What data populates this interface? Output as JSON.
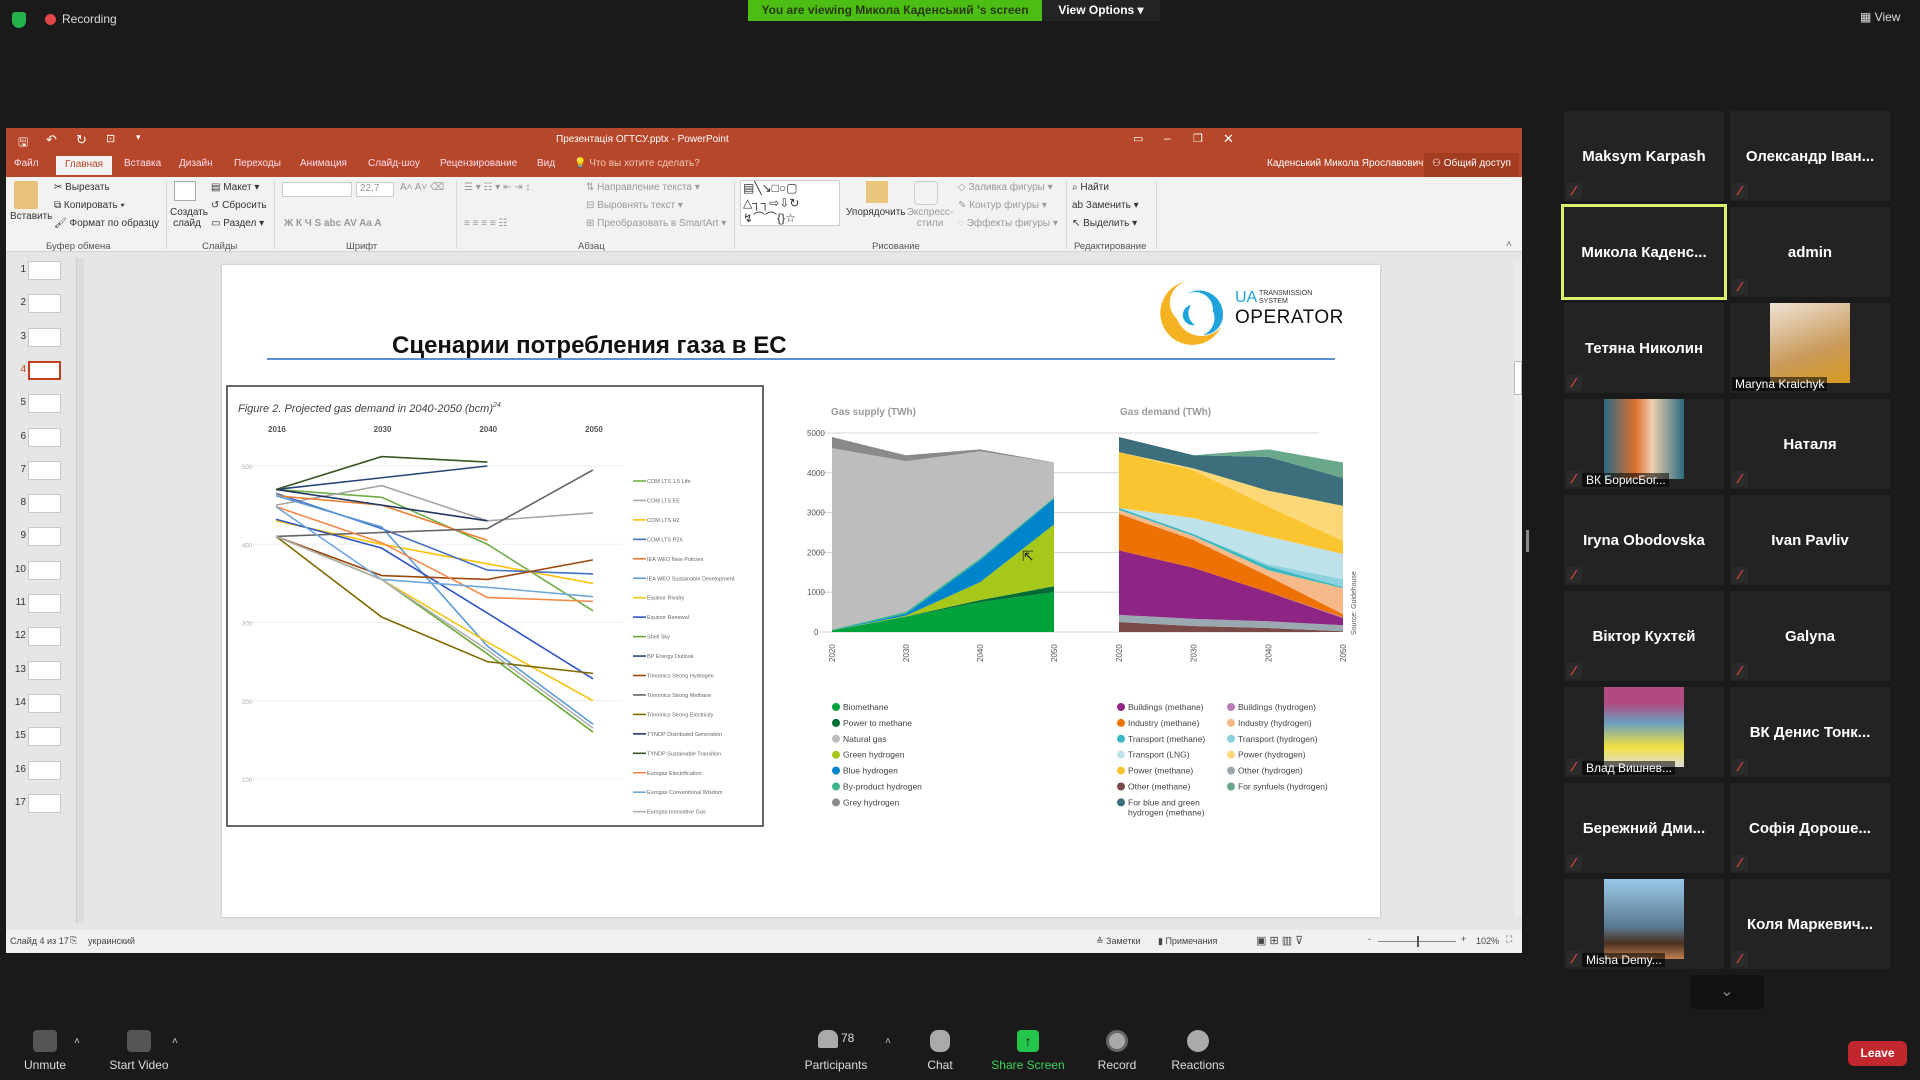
{
  "zoom_top": {
    "recording": "Recording",
    "banner": "You are viewing Микола Каденський 's screen",
    "view_options": "View Options",
    "view": "View"
  },
  "ppt": {
    "title": "Презентація ОГТСУ.pptx - PowerPoint",
    "user": "Каденський Микола Ярославович",
    "share": "Общий доступ",
    "tabs": [
      "Файл",
      "Главная",
      "Вставка",
      "Дизайн",
      "Переходы",
      "Анимация",
      "Слайд-шоу",
      "Рецензирование",
      "Вид"
    ],
    "tell_me": "Что вы хотите сделать?",
    "ribbon": {
      "paste": "Вставить",
      "cut": "Вырезать",
      "copy": "Копировать",
      "format_painter": "Формат по образцу",
      "new_slide": "Создать слайд",
      "layout": "Макет",
      "reset": "Сбросить",
      "section": "Раздел",
      "font_size": "22,7",
      "text_direction": "Направление текста",
      "align_text": "Выровнять текст",
      "smartart": "Преобразовать в SmartArt",
      "arrange": "Упорядочить",
      "quick_styles": "Экспресс-стили",
      "shape_fill": "Заливка фигуры",
      "shape_outline": "Контур фигуры",
      "shape_effects": "Эффекты фигуры",
      "find": "Найти",
      "replace": "Заменить",
      "select": "Выделить",
      "groups": [
        "Буфер обмена",
        "Слайды",
        "Шрифт",
        "Абзац",
        "Рисование",
        "Редактирование"
      ]
    },
    "slide_count": 17,
    "current_slide": 4,
    "status": {
      "slide": "Слайд 4 из 17",
      "lang": "украинский",
      "notes": "Заметки",
      "comments": "Примечания",
      "zoom": "102%",
      "zoom_level": 0.5
    }
  },
  "slide": {
    "title": "Сценарии потребления газа в ЕС",
    "logo": {
      "ua": "UA",
      "line1": "TRANSMISSION",
      "line2": "SYSTEM",
      "operator": "OPERATOR"
    },
    "source": "Source: Guidehouse"
  },
  "chart_data": [
    {
      "type": "line",
      "title": "Figure 2. Projected gas demand in 2040-2050 (bcm)",
      "title_sup": "24",
      "categories": [
        "2016",
        "2030",
        "2040",
        "2050"
      ],
      "yticks": [
        100,
        200,
        300,
        400,
        500
      ],
      "ylim": [
        50,
        530
      ],
      "grid": true,
      "legend": "right",
      "series": [
        {
          "name": "COM LTS 1.5 Life",
          "color": "#70ad47",
          "values": [
            470,
            460,
            400,
            315
          ]
        },
        {
          "name": "COM LTS EE",
          "color": "#a5a5a5",
          "values": [
            450,
            475,
            430,
            440
          ]
        },
        {
          "name": "COM LTS H2",
          "color": "#ffc000",
          "values": [
            430,
            400,
            375,
            350
          ]
        },
        {
          "name": "COM LTS P2X",
          "color": "#4472c4",
          "values": [
            465,
            420,
            367,
            362
          ]
        },
        {
          "name": "IEA WEO New Policies",
          "color": "#ed7d31",
          "values": [
            462,
            450,
            405,
            null
          ]
        },
        {
          "name": "IEA WEO Sustainable Development",
          "color": "#5b9bd5",
          "values": [
            462,
            422,
            270,
            170
          ]
        },
        {
          "name": "Equinor Rivalry",
          "color": "#f5c518",
          "values": [
            410,
            355,
            275,
            200
          ]
        },
        {
          "name": "Equinor Renewal",
          "color": "#2f55c4",
          "values": [
            432,
            395,
            312,
            228
          ]
        },
        {
          "name": "Shell Sky",
          "color": "#6aaa3a",
          "values": [
            410,
            355,
            260,
            160
          ]
        },
        {
          "name": "BP Energy Outlook",
          "color": "#264478",
          "values": [
            470,
            485,
            500,
            null
          ]
        },
        {
          "name": "Trinomics Strong Hydrogen",
          "color": "#9e480e",
          "values": [
            410,
            360,
            355,
            380
          ]
        },
        {
          "name": "Trinomics Strong Methane",
          "color": "#636363",
          "values": [
            410,
            415,
            420,
            495
          ]
        },
        {
          "name": "Trinomics Strong Electricity",
          "color": "#806a00",
          "values": [
            410,
            307,
            250,
            235
          ]
        },
        {
          "name": "TYNDP Distributed Generation",
          "color": "#1f3864",
          "values": [
            470,
            450,
            430,
            null
          ]
        },
        {
          "name": "TYNDP Sustainable Transition",
          "color": "#375623",
          "values": [
            470,
            512,
            505,
            null
          ]
        },
        {
          "name": "Eurogas Electrification",
          "color": "#f4894a",
          "values": [
            448,
            402,
            332,
            327
          ]
        },
        {
          "name": "Eurogas Conventional Wisdom",
          "color": "#6fa8dc",
          "values": [
            448,
            355,
            345,
            333
          ]
        },
        {
          "name": "Eurogas Innovative Gas",
          "color": "#b0b0b0",
          "values": [
            410,
            355,
            265,
            165
          ]
        }
      ]
    },
    {
      "type": "area",
      "stacked": true,
      "title": "Gas supply (TWh)",
      "categories": [
        "2020",
        "2030",
        "2040",
        "2050"
      ],
      "yticks": [
        0,
        1000,
        2000,
        3000,
        4000,
        5000
      ],
      "ylim": [
        0,
        5000
      ],
      "legend": "bottom",
      "series": [
        {
          "name": "Biomethane",
          "color": "#00a23c",
          "values": [
            40,
            380,
            750,
            1000
          ]
        },
        {
          "name": "Power to methane",
          "color": "#006b35",
          "values": [
            0,
            10,
            50,
            150
          ]
        },
        {
          "name": "Natural gas",
          "color": "#bdbdbd",
          "values": [
            4560,
            3780,
            2690,
            870
          ]
        },
        {
          "name": "Green hydrogen",
          "color": "#a6c81a",
          "values": [
            0,
            20,
            450,
            1550
          ]
        },
        {
          "name": "Blue hydrogen",
          "color": "#0084cc",
          "values": [
            0,
            50,
            550,
            650
          ]
        },
        {
          "name": "By-product hydrogen",
          "color": "#3db58f",
          "values": [
            20,
            50,
            50,
            30
          ]
        },
        {
          "name": "Grey hydrogen",
          "color": "#8a8a8a",
          "values": [
            280,
            150,
            50,
            10
          ]
        }
      ]
    },
    {
      "type": "area",
      "stacked": true,
      "title": "Gas demand (TWh)",
      "categories": [
        "2020",
        "2030",
        "2040",
        "2050"
      ],
      "ylim": [
        0,
        5000
      ],
      "legend": "bottom",
      "series": [
        {
          "name": "Buildings (methane)",
          "color": "#8e2585",
          "values": [
            1620,
            1280,
            730,
            180
          ]
        },
        {
          "name": "Industry (methane)",
          "color": "#ee7203",
          "values": [
            920,
            700,
            400,
            80
          ]
        },
        {
          "name": "Transport (methane)",
          "color": "#3cb9c1",
          "values": [
            50,
            50,
            100,
            30
          ]
        },
        {
          "name": "Transport (LNG)",
          "color": "#bfe2ea",
          "values": [
            0,
            400,
            700,
            630
          ]
        },
        {
          "name": "Power (methane)",
          "color": "#fbc531",
          "values": [
            1400,
            1200,
            750,
            330
          ]
        },
        {
          "name": "Other (methane)",
          "color": "#7a4a48",
          "values": [
            250,
            150,
            100,
            20
          ]
        },
        {
          "name": "For blue and green hydrogen (methane)",
          "color": "#3c6e7b",
          "values": [
            380,
            330,
            850,
            700
          ]
        },
        {
          "name": "Buildings (hydrogen)",
          "color": "#b57cb8",
          "values": [
            0,
            0,
            0,
            20
          ]
        },
        {
          "name": "Industry (hydrogen)",
          "color": "#f5b98a",
          "values": [
            100,
            100,
            150,
            650
          ]
        },
        {
          "name": "Transport (hydrogen)",
          "color": "#8ad3de",
          "values": [
            0,
            0,
            50,
            200
          ]
        },
        {
          "name": "Power (hydrogen)",
          "color": "#fcd878",
          "values": [
            0,
            50,
            400,
            880
          ]
        },
        {
          "name": "Other (hydrogen)",
          "color": "#9aa9b0",
          "values": [
            180,
            180,
            170,
            150
          ]
        },
        {
          "name": "For synfuels (hydrogen)",
          "color": "#6aa88c",
          "values": [
            0,
            0,
            190,
            390
          ]
        }
      ]
    }
  ],
  "participants": [
    {
      "name": "Maksym Karpash",
      "muted": true
    },
    {
      "name": "Олександр Іван...",
      "muted": true
    },
    {
      "name": "Микола  Каденс...",
      "muted": false,
      "active": true
    },
    {
      "name": "admin",
      "muted": true
    },
    {
      "name": "Тетяна Николин",
      "muted": true
    },
    {
      "name": "Maryna Kraichyk",
      "muted": false,
      "video": true
    },
    {
      "name": "ВК БорисБог...",
      "muted": true,
      "video": true
    },
    {
      "name": "Наталя",
      "muted": true
    },
    {
      "name": "Iryna Obodovska",
      "muted": true
    },
    {
      "name": "Ivan Pavliv",
      "muted": true
    },
    {
      "name": "Віктор Кухтєй",
      "muted": true
    },
    {
      "name": "Galyna",
      "muted": true
    },
    {
      "name": "Влад Вишнев...",
      "muted": true,
      "video": true
    },
    {
      "name": "ВК Денис Тонк...",
      "muted": true
    },
    {
      "name": "Бережний  Дми...",
      "muted": true
    },
    {
      "name": "Софія  Дороше...",
      "muted": true
    },
    {
      "name": "Misha Demy...",
      "muted": true,
      "video": true
    },
    {
      "name": "Коля  Маркевич...",
      "muted": true
    }
  ],
  "toolbar": {
    "unmute": "Unmute",
    "start_video": "Start Video",
    "participants": "Participants",
    "participants_count": "78",
    "chat": "Chat",
    "share_screen": "Share Screen",
    "record": "Record",
    "reactions": "Reactions",
    "leave": "Leave"
  }
}
